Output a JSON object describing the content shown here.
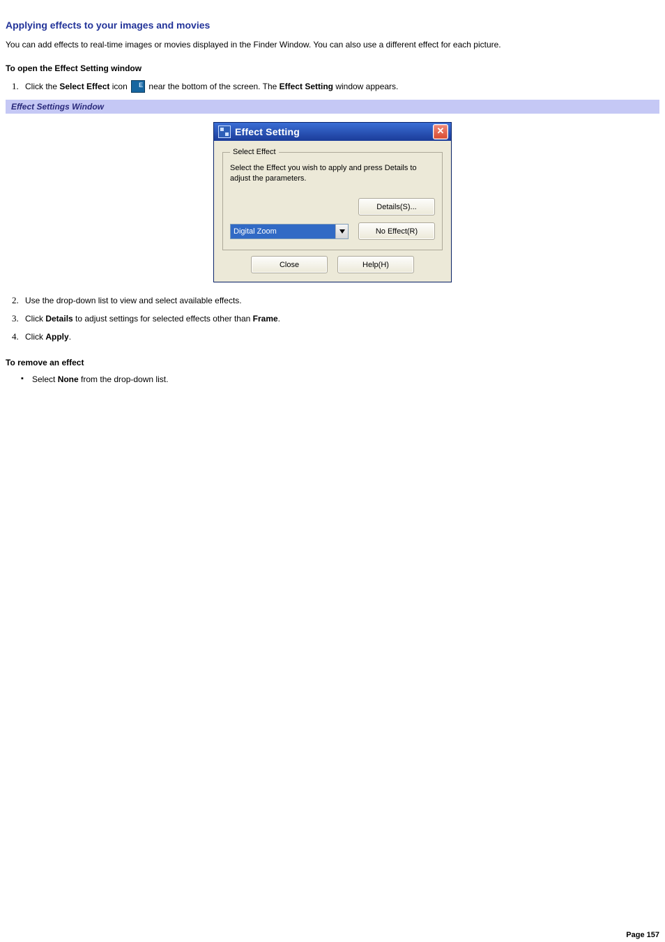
{
  "title": "Applying effects to your images and movies",
  "intro": "You can add effects to real-time images or movies displayed in the Finder Window. You can also use a different effect for each picture.",
  "section_open_heading": "To open the Effect Setting window",
  "step1": {
    "pre": "Click the ",
    "bold1": "Select Effect",
    "mid": " icon ",
    "post": " near the bottom of the screen. The ",
    "bold2": "Effect Setting",
    "tail": " window appears."
  },
  "caption": "Effect Settings Window",
  "dialog": {
    "title": "Effect Setting",
    "close_glyph": "✕",
    "group_legend": "Select Effect",
    "group_desc": "Select the Effect you wish to apply and press Details to adjust the parameters.",
    "details_btn": "Details(S)...",
    "noeffect_btn": "No Effect(R)",
    "combo_value": "Digital Zoom",
    "close_btn": "Close",
    "help_btn": "Help(H)"
  },
  "step2": "Use the drop-down list to view and select available effects.",
  "step3": {
    "pre": "Click ",
    "b1": "Details",
    "mid": " to adjust settings for selected effects other than ",
    "b2": "Frame",
    "tail": "."
  },
  "step4": {
    "pre": "Click ",
    "b1": "Apply",
    "tail": "."
  },
  "section_remove_heading": "To remove an effect",
  "remove_item": {
    "pre": "Select ",
    "b1": "None",
    "tail": " from the drop-down list."
  },
  "page_number": "Page 157"
}
